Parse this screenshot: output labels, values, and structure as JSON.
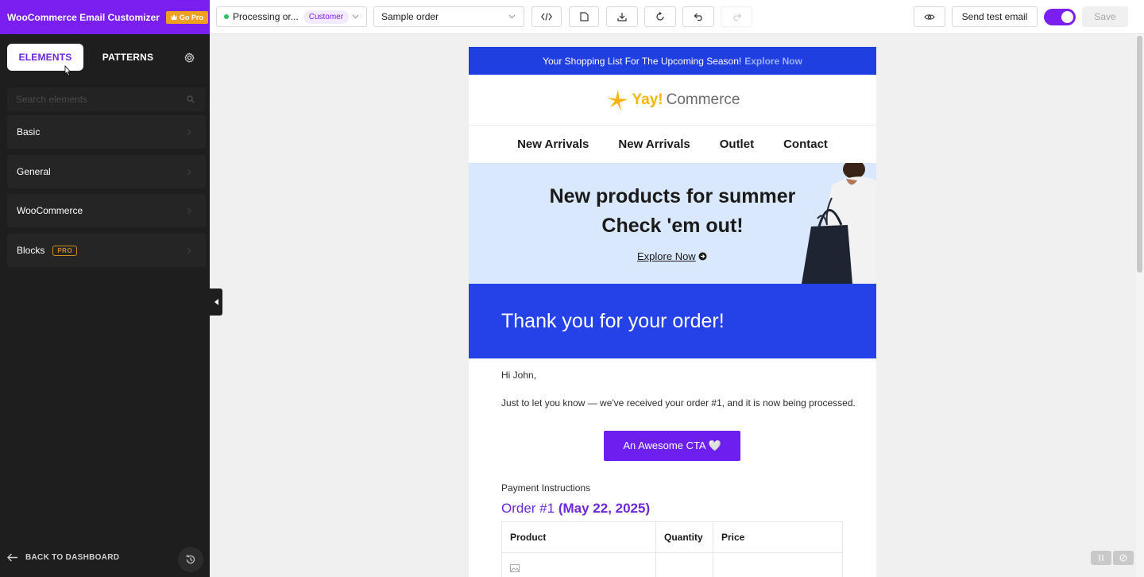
{
  "brand": {
    "title": "WooCommerce Email Customizer",
    "go_pro": "Go Pro"
  },
  "sidebar": {
    "tabs": [
      {
        "label": "ELEMENTS"
      },
      {
        "label": "PATTERNS"
      }
    ],
    "search_placeholder": "Search elements",
    "categories": [
      {
        "label": "Basic"
      },
      {
        "label": "General"
      },
      {
        "label": "WooCommerce"
      },
      {
        "label": "Blocks",
        "badge": "PRO"
      }
    ],
    "back_label": "BACK TO DASHBOARD"
  },
  "toolbar": {
    "status": "Processing or...",
    "role": "Customer",
    "order_select": "Sample order",
    "send_test": "Send test email",
    "save": "Save",
    "toggle_on": true
  },
  "email": {
    "topbar_text": "Your Shopping List For The Upcoming Season!",
    "topbar_link": "Explore Now",
    "logo_primary": "Yay!",
    "logo_secondary": "Commerce",
    "nav": [
      "New Arrivals",
      "New Arrivals",
      "Outlet",
      "Contact"
    ],
    "hero_line1": "New products for summer",
    "hero_line2": "Check 'em out!",
    "hero_link": "Explore Now",
    "thanks": "Thank you for your order!",
    "greeting": "Hi John,",
    "message": "Just to let you know — we've received your order #1, and it is now being processed.",
    "cta": "An Awesome CTA 🤍",
    "payment": "Payment Instructions",
    "order_label": "Order #1",
    "order_date": "(May 22, 2025)",
    "table_headers": [
      "Product",
      "Quantity",
      "Price"
    ]
  },
  "colors": {
    "brand_purple": "#7b1ff0",
    "topbar_blue": "#1f3fe0",
    "thanks_blue": "#2442e8",
    "cta_purple": "#6d1ff0",
    "hero_bg": "#d9e8fc",
    "sidebar_bg": "#1e1e1e"
  }
}
